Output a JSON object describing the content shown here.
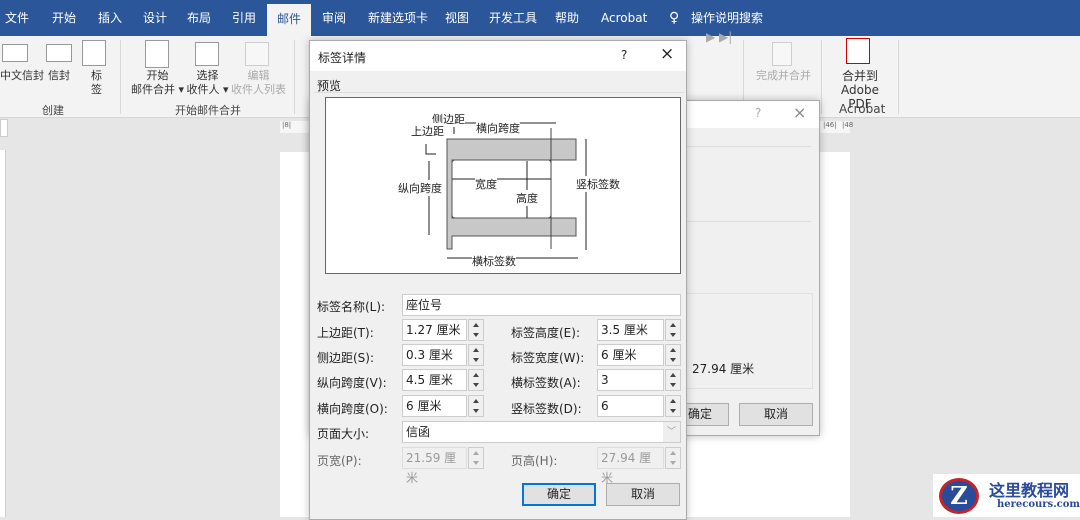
{
  "tabs": [
    "文件",
    "开始",
    "插入",
    "设计",
    "布局",
    "引用",
    "邮件",
    "审阅",
    "新建选项卡",
    "视图",
    "开发工具",
    "帮助",
    "Acrobat"
  ],
  "active_tab": "邮件",
  "search_label": "操作说明搜索",
  "ribbon": {
    "create": {
      "items": [
        "中文信封",
        "信封",
        "标",
        "签"
      ],
      "label": "创建"
    },
    "start_merge": {
      "start": [
        "开始",
        "邮件合并 ▾"
      ],
      "select": [
        "选择",
        "收件人 ▾"
      ],
      "edit": [
        "编辑",
        "收件人列表"
      ],
      "label": "开始邮件合并"
    },
    "finish": "完成并合并",
    "acrobat": {
      "button": [
        "合并到",
        "Adobe PDF"
      ],
      "label": "Acrobat"
    }
  },
  "ruler_marks": [
    "|8|",
    "|46|",
    "|48"
  ],
  "bg_dialog": {
    "help": "?",
    "close": "×",
    "value": "27.94 厘米",
    "ok": "确定",
    "cancel": "取消"
  },
  "dialog": {
    "title": "标签详情",
    "help": "?",
    "close": "×",
    "preview_label": "预览",
    "diagram": {
      "side_margin": "侧边距",
      "top_margin": "上边距",
      "horizontal_pitch": "横向跨度",
      "vertical_pitch": "纵向跨度",
      "width": "宽度",
      "height": "高度",
      "number_down": "竖标签数",
      "number_across": "横标签数"
    },
    "label_name": {
      "label": "标签名称(L):",
      "value": "座位号"
    },
    "fields": [
      {
        "label": "上边距(T):",
        "value": "1.27 厘米"
      },
      {
        "label": "标签高度(E):",
        "value": "3.5 厘米"
      },
      {
        "label": "侧边距(S):",
        "value": "0.3 厘米"
      },
      {
        "label": "标签宽度(W):",
        "value": "6 厘米"
      },
      {
        "label": "纵向跨度(V):",
        "value": "4.5 厘米"
      },
      {
        "label": "横标签数(A):",
        "value": "3"
      },
      {
        "label": "横向跨度(O):",
        "value": "6 厘米"
      },
      {
        "label": "竖标签数(D):",
        "value": "6"
      }
    ],
    "page_size": {
      "label": "页面大小:",
      "value": "信函"
    },
    "page_width": {
      "label": "页宽(P):",
      "value": "21.59 厘米"
    },
    "page_height": {
      "label": "页高(H):",
      "value": "27.94 厘米"
    },
    "ok": "确定",
    "cancel": "取消"
  },
  "watermark": {
    "name": "这里教程网",
    "url": "herecours.com"
  },
  "colors": {
    "title_bar": "#2b579a",
    "ribbon": "#f3f3f3",
    "dialog": "#f0f0f0",
    "default_button": "#0078d7"
  }
}
